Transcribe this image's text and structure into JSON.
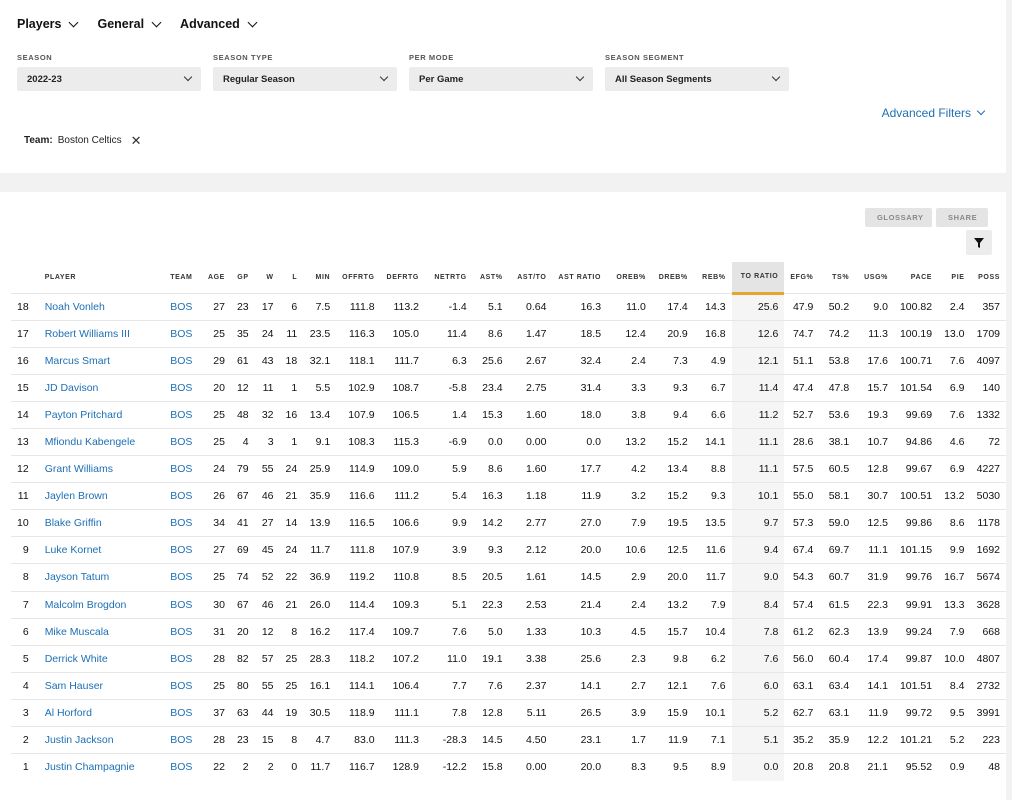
{
  "nav": [
    {
      "label": "Players"
    },
    {
      "label": "General"
    },
    {
      "label": "Advanced"
    }
  ],
  "filters": [
    {
      "label": "SEASON",
      "value": "2022-23"
    },
    {
      "label": "SEASON TYPE",
      "value": "Regular Season"
    },
    {
      "label": "PER MODE",
      "value": "Per Game"
    },
    {
      "label": "SEASON SEGMENT",
      "value": "All Season Segments"
    }
  ],
  "advanced_filters": "Advanced Filters",
  "team_tag": {
    "key": "Team:",
    "value": "Boston Celtics"
  },
  "buttons": {
    "glossary": "GLOSSARY",
    "share": "SHARE"
  },
  "accent": "#1d6fb5",
  "sort_color": "#e3a72f",
  "table": {
    "headers": [
      "",
      "PLAYER",
      "TEAM",
      "AGE",
      "GP",
      "W",
      "L",
      "MIN",
      "OFFRTG",
      "DEFRTG",
      "NETRTG",
      "AST%",
      "AST/TO",
      "AST RATIO",
      "OREB%",
      "DREB%",
      "REB%",
      "TO RATIO",
      "EFG%",
      "TS%",
      "USG%",
      "PACE",
      "PIE",
      "POSS"
    ],
    "sorted_col": 17,
    "rows": [
      [
        "18",
        "Noah Vonleh",
        "BOS",
        "27",
        "23",
        "17",
        "6",
        "7.5",
        "111.8",
        "113.2",
        "-1.4",
        "5.1",
        "0.64",
        "16.3",
        "11.0",
        "17.4",
        "14.3",
        "25.6",
        "47.9",
        "50.2",
        "9.0",
        "100.82",
        "2.4",
        "357"
      ],
      [
        "17",
        "Robert Williams III",
        "BOS",
        "25",
        "35",
        "24",
        "11",
        "23.5",
        "116.3",
        "105.0",
        "11.4",
        "8.6",
        "1.47",
        "18.5",
        "12.4",
        "20.9",
        "16.8",
        "12.6",
        "74.7",
        "74.2",
        "11.3",
        "100.19",
        "13.0",
        "1709"
      ],
      [
        "16",
        "Marcus Smart",
        "BOS",
        "29",
        "61",
        "43",
        "18",
        "32.1",
        "118.1",
        "111.7",
        "6.3",
        "25.6",
        "2.67",
        "32.4",
        "2.4",
        "7.3",
        "4.9",
        "12.1",
        "51.1",
        "53.8",
        "17.6",
        "100.71",
        "7.6",
        "4097"
      ],
      [
        "15",
        "JD Davison",
        "BOS",
        "20",
        "12",
        "11",
        "1",
        "5.5",
        "102.9",
        "108.7",
        "-5.8",
        "23.4",
        "2.75",
        "31.4",
        "3.3",
        "9.3",
        "6.7",
        "11.4",
        "47.4",
        "47.8",
        "15.7",
        "101.54",
        "6.9",
        "140"
      ],
      [
        "14",
        "Payton Pritchard",
        "BOS",
        "25",
        "48",
        "32",
        "16",
        "13.4",
        "107.9",
        "106.5",
        "1.4",
        "15.3",
        "1.60",
        "18.0",
        "3.8",
        "9.4",
        "6.6",
        "11.2",
        "52.7",
        "53.6",
        "19.3",
        "99.69",
        "7.6",
        "1332"
      ],
      [
        "13",
        "Mfiondu Kabengele",
        "BOS",
        "25",
        "4",
        "3",
        "1",
        "9.1",
        "108.3",
        "115.3",
        "-6.9",
        "0.0",
        "0.00",
        "0.0",
        "13.2",
        "15.2",
        "14.1",
        "11.1",
        "28.6",
        "38.1",
        "10.7",
        "94.86",
        "4.6",
        "72"
      ],
      [
        "12",
        "Grant Williams",
        "BOS",
        "24",
        "79",
        "55",
        "24",
        "25.9",
        "114.9",
        "109.0",
        "5.9",
        "8.6",
        "1.60",
        "17.7",
        "4.2",
        "13.4",
        "8.8",
        "11.1",
        "57.5",
        "60.5",
        "12.8",
        "99.67",
        "6.9",
        "4227"
      ],
      [
        "11",
        "Jaylen Brown",
        "BOS",
        "26",
        "67",
        "46",
        "21",
        "35.9",
        "116.6",
        "111.2",
        "5.4",
        "16.3",
        "1.18",
        "11.9",
        "3.2",
        "15.2",
        "9.3",
        "10.1",
        "55.0",
        "58.1",
        "30.7",
        "100.51",
        "13.2",
        "5030"
      ],
      [
        "10",
        "Blake Griffin",
        "BOS",
        "34",
        "41",
        "27",
        "14",
        "13.9",
        "116.5",
        "106.6",
        "9.9",
        "14.2",
        "2.77",
        "27.0",
        "7.9",
        "19.5",
        "13.5",
        "9.7",
        "57.3",
        "59.0",
        "12.5",
        "99.86",
        "8.6",
        "1178"
      ],
      [
        "9",
        "Luke Kornet",
        "BOS",
        "27",
        "69",
        "45",
        "24",
        "11.7",
        "111.8",
        "107.9",
        "3.9",
        "9.3",
        "2.12",
        "20.0",
        "10.6",
        "12.5",
        "11.6",
        "9.4",
        "67.4",
        "69.7",
        "11.1",
        "101.15",
        "9.9",
        "1692"
      ],
      [
        "8",
        "Jayson Tatum",
        "BOS",
        "25",
        "74",
        "52",
        "22",
        "36.9",
        "119.2",
        "110.8",
        "8.5",
        "20.5",
        "1.61",
        "14.5",
        "2.9",
        "20.0",
        "11.7",
        "9.0",
        "54.3",
        "60.7",
        "31.9",
        "99.76",
        "16.7",
        "5674"
      ],
      [
        "7",
        "Malcolm Brogdon",
        "BOS",
        "30",
        "67",
        "46",
        "21",
        "26.0",
        "114.4",
        "109.3",
        "5.1",
        "22.3",
        "2.53",
        "21.4",
        "2.4",
        "13.2",
        "7.9",
        "8.4",
        "57.4",
        "61.5",
        "22.3",
        "99.91",
        "13.3",
        "3628"
      ],
      [
        "6",
        "Mike Muscala",
        "BOS",
        "31",
        "20",
        "12",
        "8",
        "16.2",
        "117.4",
        "109.7",
        "7.6",
        "5.0",
        "1.33",
        "10.3",
        "4.5",
        "15.7",
        "10.4",
        "7.8",
        "61.2",
        "62.3",
        "13.9",
        "99.24",
        "7.9",
        "668"
      ],
      [
        "5",
        "Derrick White",
        "BOS",
        "28",
        "82",
        "57",
        "25",
        "28.3",
        "118.2",
        "107.2",
        "11.0",
        "19.1",
        "3.38",
        "25.6",
        "2.3",
        "9.8",
        "6.2",
        "7.6",
        "56.0",
        "60.4",
        "17.4",
        "99.87",
        "10.0",
        "4807"
      ],
      [
        "4",
        "Sam Hauser",
        "BOS",
        "25",
        "80",
        "55",
        "25",
        "16.1",
        "114.1",
        "106.4",
        "7.7",
        "7.6",
        "2.37",
        "14.1",
        "2.7",
        "12.1",
        "7.6",
        "6.0",
        "63.1",
        "63.4",
        "14.1",
        "101.51",
        "8.4",
        "2732"
      ],
      [
        "3",
        "Al Horford",
        "BOS",
        "37",
        "63",
        "44",
        "19",
        "30.5",
        "118.9",
        "111.1",
        "7.8",
        "12.8",
        "5.11",
        "26.5",
        "3.9",
        "15.9",
        "10.1",
        "5.2",
        "62.7",
        "63.1",
        "11.9",
        "99.72",
        "9.5",
        "3991"
      ],
      [
        "2",
        "Justin Jackson",
        "BOS",
        "28",
        "23",
        "15",
        "8",
        "4.7",
        "83.0",
        "111.3",
        "-28.3",
        "14.5",
        "4.50",
        "23.1",
        "1.7",
        "11.9",
        "7.1",
        "5.1",
        "35.2",
        "35.9",
        "12.2",
        "101.21",
        "5.2",
        "223"
      ],
      [
        "1",
        "Justin Champagnie",
        "BOS",
        "22",
        "2",
        "2",
        "0",
        "11.7",
        "116.7",
        "128.9",
        "-12.2",
        "15.8",
        "0.00",
        "20.0",
        "8.3",
        "9.5",
        "8.9",
        "0.0",
        "20.8",
        "20.8",
        "21.1",
        "95.52",
        "0.9",
        "48"
      ]
    ]
  }
}
